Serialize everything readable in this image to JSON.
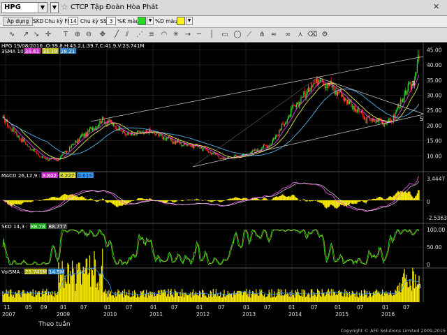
{
  "topbar": {
    "ticker": "HPG",
    "company": "CTCP Tập Đoàn Hòa Phát"
  },
  "settings": {
    "apply": "Áp dụng",
    "skd": "SKD",
    "k_period_label": "Chu kỳ FK",
    "k_period_value": "14",
    "sd_period_label": "Chu kỳ SSD",
    "sd_period_value": "3",
    "k_color_label": "%K màu",
    "k_color": "#22dd22",
    "d_color_label": "%D màu",
    "d_color": "#ffee22"
  },
  "toolbar": {
    "tools": [
      "line-tool-icon",
      "arrow-up-icon",
      "arrow-down-icon",
      "crosshair-icon",
      "text-tool-icon",
      "zoom-in-icon",
      "zoom-out-icon",
      "pan-icon",
      "trendline-icon",
      "channel-icon",
      "fib-fan-icon",
      "fib-retracement-icon",
      "fib-arc-icon",
      "gann-icon",
      "ray-icon",
      "horizontal-line-icon",
      "vertical-line-icon",
      "rectangle-icon",
      "ellipse-icon",
      "speed-line-icon",
      "pitchfork-icon",
      "regression-icon",
      "cycle-icon",
      "andrews-icon",
      "erase-icon",
      "settings-icon"
    ]
  },
  "panels": {
    "price": {
      "header": "HPG 19/08/2016 :O:39.8,H:43.2,L:39.7,C:41.9,V:23.741M",
      "sma_label": "3SMA 10,",
      "sma_values": [
        "36.61",
        "31.19",
        "28.21"
      ],
      "yticks": [
        "45.00",
        "40.00",
        "35.00",
        "30.00",
        "25.00",
        "20.00",
        "15.00",
        "10.00"
      ],
      "annotations": [
        "3",
        "5"
      ]
    },
    "macd": {
      "label": "MACD 26,12,9 :",
      "values": [
        "3.842",
        "3.227",
        "0.615"
      ],
      "yticks": [
        "3.4447",
        "0",
        "-2.5363"
      ]
    },
    "skd": {
      "label": "SKD 14,3 :",
      "values": [
        "88.78",
        "88.777"
      ],
      "yticks": [
        "100.00",
        "50.00",
        "0"
      ]
    },
    "volume": {
      "label": "VolSMA :",
      "values": [
        "23.741M",
        "14.5M"
      ],
      "yticks": [
        "8"
      ]
    }
  },
  "xaxis": {
    "months": [
      "11",
      "05",
      "09",
      "01",
      "07",
      "01",
      "07",
      "01",
      "07",
      "01",
      "07",
      "01",
      "07",
      "01",
      "07",
      "01",
      "07",
      "01",
      "07",
      "01",
      "07"
    ],
    "years": [
      "2007",
      "2009",
      "2010",
      "2011",
      "2012",
      "2013",
      "2014",
      "2015",
      "2016"
    ]
  },
  "bottom": {
    "period": "Theo tuần",
    "copyright": "Copyright © AFE Solutions Limited 2009-2015"
  },
  "chart_data": {
    "type": "candlestick",
    "ticker": "HPG",
    "interval": "weekly",
    "title": "HPG 19/08/2016",
    "last_bar": {
      "date": "2016-08-19",
      "open": 39.8,
      "high": 43.2,
      "low": 39.7,
      "close": 41.9,
      "volume": "23.741M"
    },
    "price_ylim": [
      5,
      46
    ],
    "x": [
      "2007-11",
      "2008-05",
      "2008-09",
      "2009-01",
      "2009-07",
      "2010-01",
      "2010-07",
      "2011-01",
      "2011-07",
      "2012-01",
      "2012-07",
      "2013-01",
      "2013-07",
      "2014-01",
      "2014-07",
      "2015-01",
      "2015-07",
      "2016-01",
      "2016-07",
      "2016-08"
    ],
    "close": [
      22,
      14,
      9.5,
      8.5,
      16,
      22,
      17,
      18,
      14.5,
      13,
      9,
      10.5,
      14,
      26,
      36,
      30,
      22,
      21,
      35,
      41.9
    ],
    "sma": [
      {
        "name": "SMA 10",
        "color": "#ff44ff",
        "last": 36.61
      },
      {
        "name": "SMA 20",
        "color": "#ffff55",
        "last": 31.19
      },
      {
        "name": "SMA 50",
        "color": "#5bc8ff",
        "last": 28.21
      }
    ],
    "macd": {
      "params": "26,12,9",
      "macd": 3.842,
      "signal": 3.227,
      "hist": 0.615,
      "ylim": [
        -2.5363,
        3.4447
      ]
    },
    "stochastic": {
      "params": "14,3",
      "k": 88.78,
      "d": 88.777,
      "ylim": [
        0,
        100
      ]
    },
    "volume": {
      "last": "23.741M",
      "sma": "14.5M"
    }
  }
}
